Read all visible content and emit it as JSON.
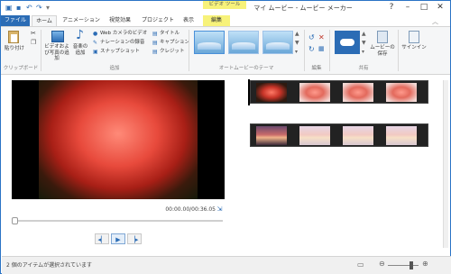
{
  "window": {
    "title": "マイ ムービー - ムービー メーカー",
    "contextual_group": "ビデオ ツール"
  },
  "tabs": [
    "ファイル",
    "ホーム",
    "アニメーション",
    "視覚効果",
    "プロジェクト",
    "表示",
    "編集"
  ],
  "ribbon": {
    "clipboard": {
      "paste": "貼り付け",
      "group": "クリップボード"
    },
    "add": {
      "add_videos": "ビデオおよび写真の追加",
      "add_music": "音楽の追加",
      "webcam": "Web カメラのビデオ",
      "narration": "ナレーションの録音",
      "snapshot": "スナップショット",
      "title": "タイトル",
      "caption": "キャプション",
      "credits": "クレジット",
      "group": "追加"
    },
    "themes": {
      "group": "オートムービーのテーマ"
    },
    "editing": {
      "group": "編集"
    },
    "share": {
      "save_movie": "ムービーの保存",
      "group": "共有"
    },
    "signin": {
      "label": "サインイン"
    }
  },
  "player": {
    "timecode": "00:00.00/00:36.05",
    "progress": 0.0
  },
  "status": {
    "text": "2 個のアイテムが選択されています"
  },
  "colors": {
    "accent": "#2b6cb5",
    "context_tab": "#f7f27a",
    "selection": "#9fc3e9"
  }
}
